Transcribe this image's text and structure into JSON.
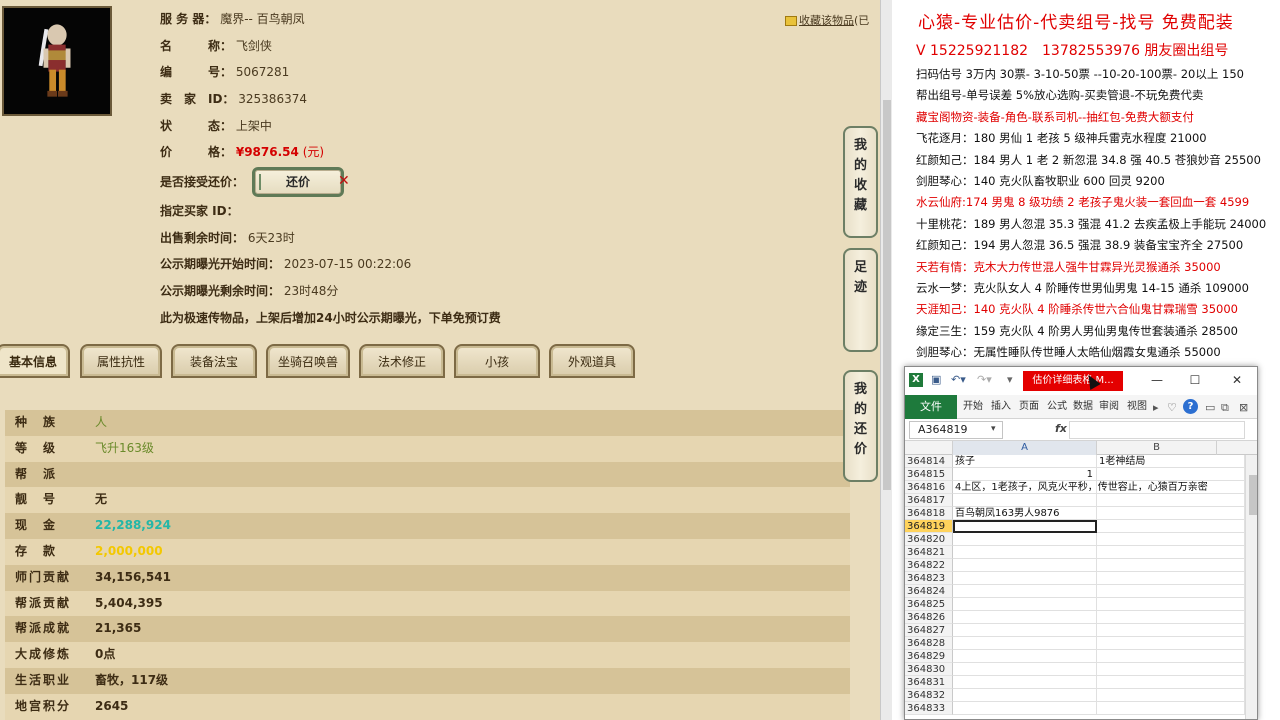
{
  "item": {
    "server_label": "服 务 器：",
    "server": "魔界-- 百鸟朝凤",
    "name_label": "名　　　称：",
    "name": "飞剑侠",
    "id_label": "编　　　号：",
    "id": "5067281",
    "seller_label": "卖　家　ID：",
    "seller": "325386374",
    "status_label": "状　　　态：",
    "status": "上架中",
    "price_label": "价　　　格：",
    "price": "¥9876.54",
    "price_unit": "(元)",
    "accept_counter_label": "是否接受还价：",
    "counter_button": "还价",
    "buyer_id_label": "指定买家 ID：",
    "remaining_label": "出售剩余时间：",
    "remaining": "6天23时",
    "publicity_start_label": "公示期曝光开始时间：",
    "publicity_start": "2023-07-15 00:22:06",
    "publicity_remaining_label": "公示期曝光剩余时间：",
    "publicity_remaining": "23时48分",
    "notice": "此为极速传物品，上架后增加24小时公示期曝光，下单免预订费",
    "collect": "收藏该物品",
    "collect_suffix": "(已"
  },
  "tabs": [
    "基本信息",
    "属性抗性",
    "装备法宝",
    "坐骑召唤兽",
    "法术修正",
    "小孩",
    "外观道具"
  ],
  "stats": [
    {
      "k": "种　族",
      "v": "人",
      "color": "#6a8a2a"
    },
    {
      "k": "等　级",
      "v": "飞升163级",
      "color": "#6a8a2a"
    },
    {
      "k": "帮　派",
      "v": "",
      "color": "#3d2c14"
    },
    {
      "k": "靓　号",
      "v": "无",
      "color": "#3d2c14"
    },
    {
      "k": "现　金",
      "v": "22,288,924",
      "color": "#23b7a8"
    },
    {
      "k": "存　款",
      "v": "2,000,000",
      "color": "#f3c800"
    },
    {
      "k": "师门贡献",
      "v": "34,156,541",
      "color": "#3d2c14"
    },
    {
      "k": "帮派贡献",
      "v": "5,404,395",
      "color": "#3d2c14"
    },
    {
      "k": "帮派成就",
      "v": "21,365",
      "color": "#3d2c14"
    },
    {
      "k": "大成修炼",
      "v": "0点",
      "color": "#3d2c14"
    },
    {
      "k": "生活职业",
      "v": "畜牧，117级",
      "color": "#3d2c14"
    },
    {
      "k": "地宫积分",
      "v": "2645",
      "color": "#3d2c14"
    }
  ],
  "side_buttons": [
    {
      "chars": [
        "我",
        "的",
        "收",
        "藏"
      ]
    },
    {
      "chars": [
        "足",
        "迹"
      ]
    },
    {
      "chars": [
        "我",
        "的",
        "还",
        "价"
      ]
    }
  ],
  "ad": {
    "title": "心猿-专业估价-代卖组号-找号 免费配装",
    "phone": "V 15225921182　13782553976 朋友圈出组号",
    "lines": [
      {
        "t": "扫码估号 3万内 30票- 3-10-50票 --10-20-100票- 20以上 150",
        "red": false
      },
      {
        "t": "帮出组号-单号误差 5%放心选购-买卖管退-不玩免费代卖",
        "red": false
      },
      {
        "t": "藏宝阁物资-装备-角色-联系司机--抽红包-免费大额支付",
        "red": true
      },
      {
        "t": "飞花逐月：180 男仙 1 老孩 5 级神兵雷克水程度 21000",
        "red": false
      },
      {
        "t": "红颜知己：184 男人 1 老 2 新忽混 34.8 强 40.5 苍狼妙音 25500",
        "red": false
      },
      {
        "t": "剑胆琴心：140 克火队畜牧职业 600 回灵 9200",
        "red": false
      },
      {
        "t": "水云仙府:174 男鬼 8 级功绩 2 老孩子鬼火装一套回血一套 4599",
        "red": true
      },
      {
        "t": "十里桃花：189 男人忽混 35.3 强混 41.2 去疾孟极上手能玩 24000",
        "red": false
      },
      {
        "t": "红颜知己：194 男人忽混 36.5 强混 38.9 装备宝宝齐全 27500",
        "red": false
      },
      {
        "t": "天若有情：克木大力传世混人强牛甘霖异光灵猴通杀 35000",
        "red": true
      },
      {
        "t": "云水一梦：克火队女人 4 阶睡传世男仙男鬼 14-15 通杀 109000",
        "red": false
      },
      {
        "t": "天涯知己：140 克火队 4 阶睡杀传世六合仙鬼甘霖瑞雪 35000",
        "red": true
      },
      {
        "t": "缘定三生：159 克火队 4 阶男人男仙男鬼传世套装通杀 28500",
        "red": false
      },
      {
        "t": "剑胆琴心：无属性睡队传世睡人太皓仙烟霞女鬼通杀 55000",
        "red": false
      }
    ]
  },
  "excel": {
    "title": "估价详细表格.M...",
    "file_tab": "文件",
    "ribbon_tabs": [
      "开始",
      "插入",
      "页面",
      "公式",
      "数据",
      "审阅",
      "视图"
    ],
    "name_box": "A364819",
    "fx": "fx",
    "col_a": "A",
    "col_b": "B",
    "rows": [
      {
        "n": "364814",
        "a": "孩子",
        "b": "1老神结局"
      },
      {
        "n": "364815",
        "a": "",
        "b": "",
        "a_num": "1"
      },
      {
        "n": "364816",
        "a": "4上区，1老孩子，风克火平秒，传世容止，心猿百万亲密",
        "b": ""
      },
      {
        "n": "364817",
        "a": "",
        "b": ""
      },
      {
        "n": "364818",
        "a": "百鸟朝凤163男人9876",
        "b": ""
      },
      {
        "n": "364819",
        "a": "",
        "b": "",
        "active": true
      },
      {
        "n": "364820",
        "a": "",
        "b": ""
      },
      {
        "n": "364821",
        "a": "",
        "b": ""
      },
      {
        "n": "364822",
        "a": "",
        "b": ""
      },
      {
        "n": "364823",
        "a": "",
        "b": ""
      },
      {
        "n": "364824",
        "a": "",
        "b": ""
      },
      {
        "n": "364825",
        "a": "",
        "b": ""
      },
      {
        "n": "364826",
        "a": "",
        "b": ""
      },
      {
        "n": "364827",
        "a": "",
        "b": ""
      },
      {
        "n": "364828",
        "a": "",
        "b": ""
      },
      {
        "n": "364829",
        "a": "",
        "b": ""
      },
      {
        "n": "364830",
        "a": "",
        "b": ""
      },
      {
        "n": "364831",
        "a": "",
        "b": ""
      },
      {
        "n": "364832",
        "a": "",
        "b": ""
      },
      {
        "n": "364833",
        "a": "",
        "b": ""
      }
    ]
  }
}
